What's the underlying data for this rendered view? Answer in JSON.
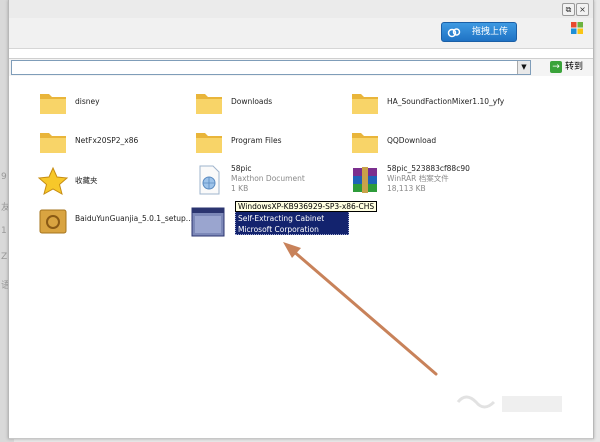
{
  "window": {
    "controls": {
      "restore": "⧉",
      "close": "×"
    }
  },
  "toolbar": {
    "upload_label": "拖拽上传",
    "upload_icon": "cloud-icon",
    "windows_logo": "windows-flag-icon"
  },
  "address": {
    "value": "",
    "dropdown": "▼",
    "go_icon": "→",
    "go_label": "转到"
  },
  "side_glyphs": [
    "9",
    "友",
    "1",
    "Z",
    "语"
  ],
  "files": [
    {
      "name": "disney",
      "type": "folder"
    },
    {
      "name": "Downloads",
      "type": "folder"
    },
    {
      "name": "HA_SoundFactionMixer1.10_yfy",
      "type": "folder"
    },
    {
      "name": "NetFx20SP2_x86",
      "type": "folder"
    },
    {
      "name": "Program Files",
      "type": "folder"
    },
    {
      "name": "QQDownload",
      "type": "folder"
    },
    {
      "name": "收藏夹",
      "type": "favorites"
    },
    {
      "name": "58pic",
      "type": "maxthon-doc",
      "line2": "Maxthon Document",
      "line3": "1 KB"
    },
    {
      "name": "58pic_523883cf88c90",
      "type": "winrar",
      "line2": "WinRAR 档案文件",
      "line3": "18,113 KB"
    },
    {
      "name": "BaiduYunGuanjia_5.0.1_setup...",
      "type": "installer"
    },
    {
      "name": "",
      "type": "cabinet",
      "line2": "Self-Extracting Cabinet",
      "line3": "Microsoft Corporation"
    }
  ],
  "tooltip": "WindowsXP-KB936929-SP3-x86-CHS",
  "colors": {
    "selection": "#13236e",
    "arrow": "#c8825a",
    "folder": "#f5c542",
    "upload_button": "#2a84d6"
  }
}
